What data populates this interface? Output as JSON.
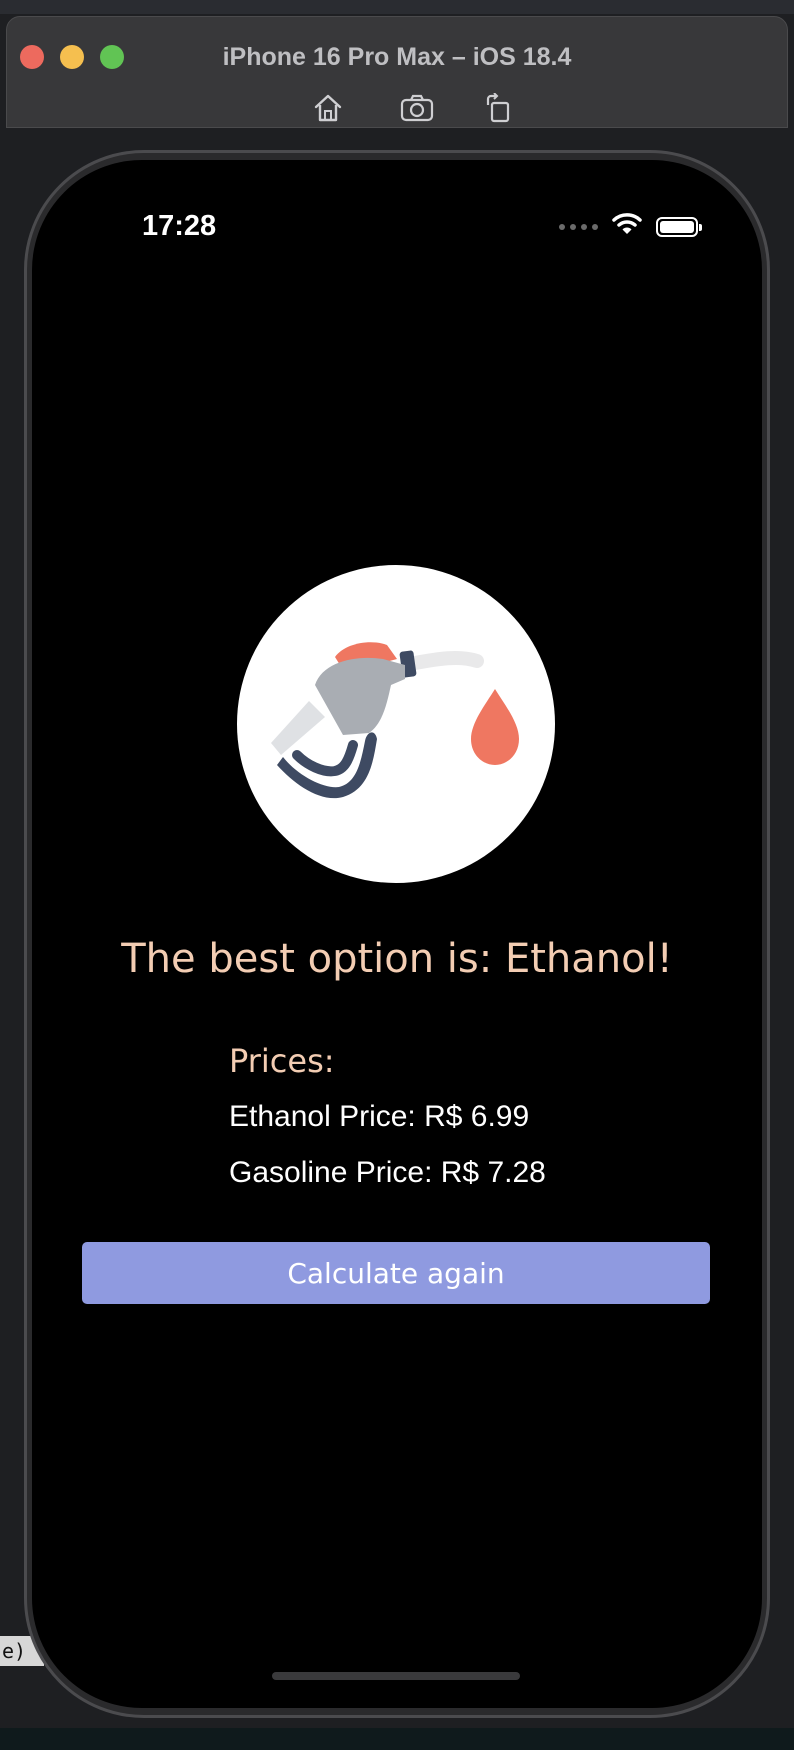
{
  "simulator": {
    "title": "iPhone 16 Pro Max – iOS 18.4",
    "toolbar": {
      "icons": [
        "home-icon",
        "screenshot-icon",
        "rotate-icon"
      ]
    }
  },
  "background": {
    "code_snippet": "e)"
  },
  "status_bar": {
    "time": "17:28",
    "icons": [
      "signal-dots-icon",
      "wifi-icon",
      "battery-icon"
    ]
  },
  "result": {
    "icon": "fuel-pump-icon",
    "title": "The best option is: Ethanol!",
    "prices_heading": "Prices:",
    "ethanol_price": "Ethanol Price: R$ 6.99",
    "gasoline_price": "Gasoline Price: R$ 7.28",
    "button_label": "Calculate again"
  },
  "colors": {
    "accent_text": "#f3cdb3",
    "button_background": "#8f9ae0",
    "screen_background": "#000000",
    "fuel_drop": "#ef7761"
  }
}
